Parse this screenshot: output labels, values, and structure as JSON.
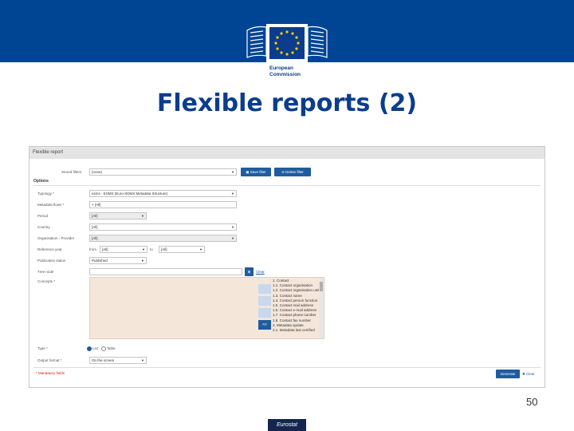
{
  "header": {
    "logo_text": [
      "European",
      "Commission"
    ],
    "brand_color": "#004494"
  },
  "slide": {
    "title": "Flexible reports (2)",
    "page_number": "50",
    "footer_badge": "Eurostat"
  },
  "app": {
    "panel_title": "Flexible report",
    "stored_filters": {
      "label": "Stored filters",
      "value": "(none)",
      "save_label": "Save filter",
      "delete_label": "Delete filter"
    },
    "options_heading": "Options",
    "fields": {
      "typology": {
        "label": "Typology *",
        "value": "esms - ESMS (Euro-SDMX Metadata Structure)"
      },
      "metadata_flows": {
        "label": "Metadata flows *",
        "value": "× [All]"
      },
      "period": {
        "label": "Period",
        "value": "[All]"
      },
      "country": {
        "label": "Country",
        "value": "[All]"
      },
      "organisation": {
        "label": "Organisation - Provider",
        "value": "[All]"
      },
      "reference_year": {
        "label": "Reference year",
        "from_label": "from",
        "from_value": "[All]",
        "to_label": "to",
        "to_value": "[All]"
      },
      "publication_status": {
        "label": "Publication status",
        "value": "Published"
      },
      "tree_node": {
        "label": "Tree node",
        "clear_label": "Clear"
      },
      "concepts": {
        "label": "Concepts *"
      },
      "type": {
        "label": "Type *",
        "option_list": "List",
        "option_table": "Table"
      },
      "output_format": {
        "label": "Output format *",
        "value": "On the screen"
      }
    },
    "concept_items": [
      "1. Contact",
      "1.1. Contact organisation",
      "1.2. Contact organisation unit",
      "1.3. Contact name",
      "1.4. Contact person function",
      "1.5. Contact mail address",
      "1.6. Contact e-mail address",
      "1.7. Contact phone number",
      "1.8. Contact fax number",
      "2. Metadata update",
      "2.1. Metadata last certified"
    ],
    "move_all_left_label": "<<",
    "mandatory_note": "* Mandatory fields",
    "generate_label": "Generate",
    "clear_label": "Clear",
    "accent_color": "#1f5c9f"
  }
}
